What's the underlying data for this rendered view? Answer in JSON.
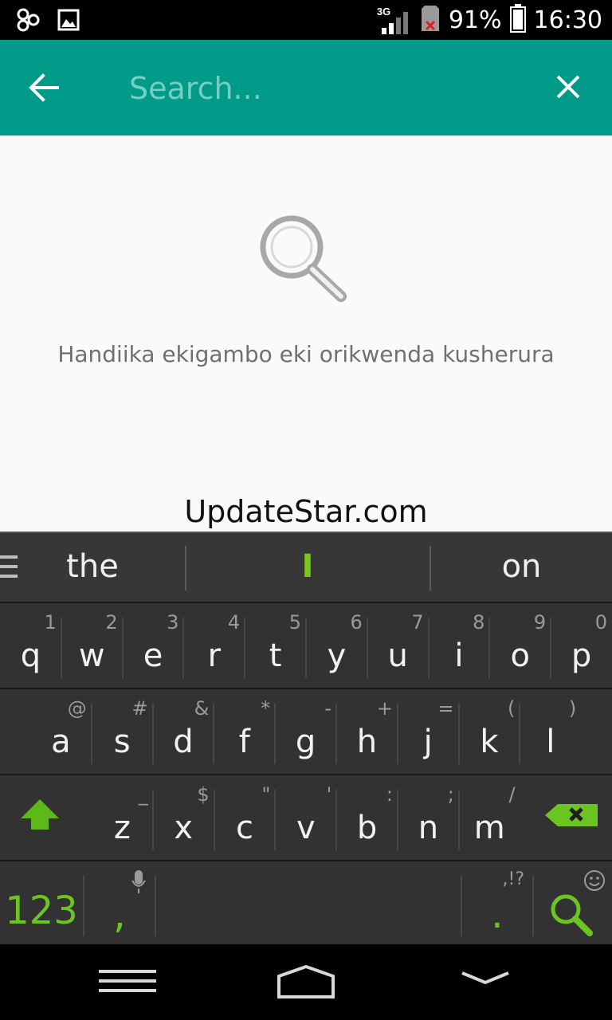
{
  "status_bar": {
    "network_type": "3G",
    "battery_percent": "91%",
    "time": "16:30",
    "icons": [
      "app-notification-icon",
      "image-notification-icon",
      "signal-icon",
      "no-sim-icon",
      "battery-icon"
    ]
  },
  "toolbar": {
    "background_color": "#009a88",
    "search_placeholder": "Search...",
    "search_value": ""
  },
  "content": {
    "empty_hint": "Handiika ekigambo eki orikwenda kusherura",
    "watermark": "UpdateStar.com"
  },
  "keyboard": {
    "suggestions": [
      "the",
      "I",
      "on"
    ],
    "accent_color": "#78c81e",
    "row1": [
      {
        "key": "q",
        "secondary": "1"
      },
      {
        "key": "w",
        "secondary": "2"
      },
      {
        "key": "e",
        "secondary": "3"
      },
      {
        "key": "r",
        "secondary": "4"
      },
      {
        "key": "t",
        "secondary": "5"
      },
      {
        "key": "y",
        "secondary": "6"
      },
      {
        "key": "u",
        "secondary": "7"
      },
      {
        "key": "i",
        "secondary": "8"
      },
      {
        "key": "o",
        "secondary": "9"
      },
      {
        "key": "p",
        "secondary": "0"
      }
    ],
    "row2": [
      {
        "key": "a",
        "secondary": "@"
      },
      {
        "key": "s",
        "secondary": "#"
      },
      {
        "key": "d",
        "secondary": "&"
      },
      {
        "key": "f",
        "secondary": "*"
      },
      {
        "key": "g",
        "secondary": "-"
      },
      {
        "key": "h",
        "secondary": "+"
      },
      {
        "key": "j",
        "secondary": "="
      },
      {
        "key": "k",
        "secondary": "("
      },
      {
        "key": "l",
        "secondary": ")"
      }
    ],
    "row3": [
      {
        "key": "z",
        "secondary": "_"
      },
      {
        "key": "x",
        "secondary": "$"
      },
      {
        "key": "c",
        "secondary": "\""
      },
      {
        "key": "v",
        "secondary": "'"
      },
      {
        "key": "b",
        "secondary": ":"
      },
      {
        "key": "n",
        "secondary": ";"
      },
      {
        "key": "m",
        "secondary": "/"
      }
    ],
    "row4": {
      "symbols_label": "123",
      "comma_label": ",",
      "period_label": ".",
      "period_secondary": ",!?"
    }
  }
}
